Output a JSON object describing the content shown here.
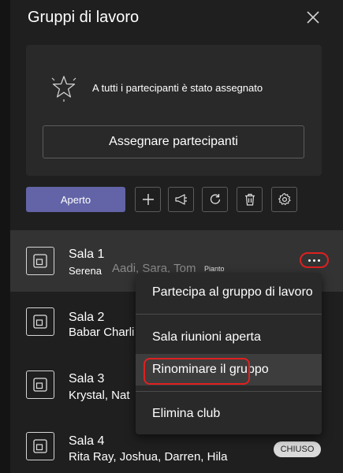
{
  "panel": {
    "title": "Gruppi di lavoro"
  },
  "assignment_card": {
    "message": "A tutti i partecipanti è stato assegnato",
    "assign_label": "Assegnare partecipanti"
  },
  "toolbar": {
    "open_label": "Aperto",
    "buttons": [
      "plus-icon",
      "announce-icon",
      "recreate-icon",
      "delete-icon",
      "settings-icon"
    ]
  },
  "rooms": [
    {
      "name": "Sala 1",
      "members": "Serena",
      "ghost_names": "Aadi, Sara, Tom",
      "ghost_tag": "Pianto"
    },
    {
      "name": "Sala 2",
      "members": "Babar Charli"
    },
    {
      "name": "Sala 3",
      "members": "Krystal, Nat"
    },
    {
      "name": "Sala 4",
      "members": "Rita Ray, Joshua, Darren, Hila",
      "badge": "CHIUSO"
    }
  ],
  "context_menu": {
    "items": [
      "Partecipa al gruppo di lavoro",
      "Sala riunioni aperta",
      "Rinominare il gruppo",
      "Elimina club"
    ],
    "highlighted": "Rinominare il gruppo"
  },
  "colors": {
    "background": "#1f1f1f",
    "card": "#292929",
    "accent": "#6264a7",
    "highlight_ring": "#e02020"
  }
}
